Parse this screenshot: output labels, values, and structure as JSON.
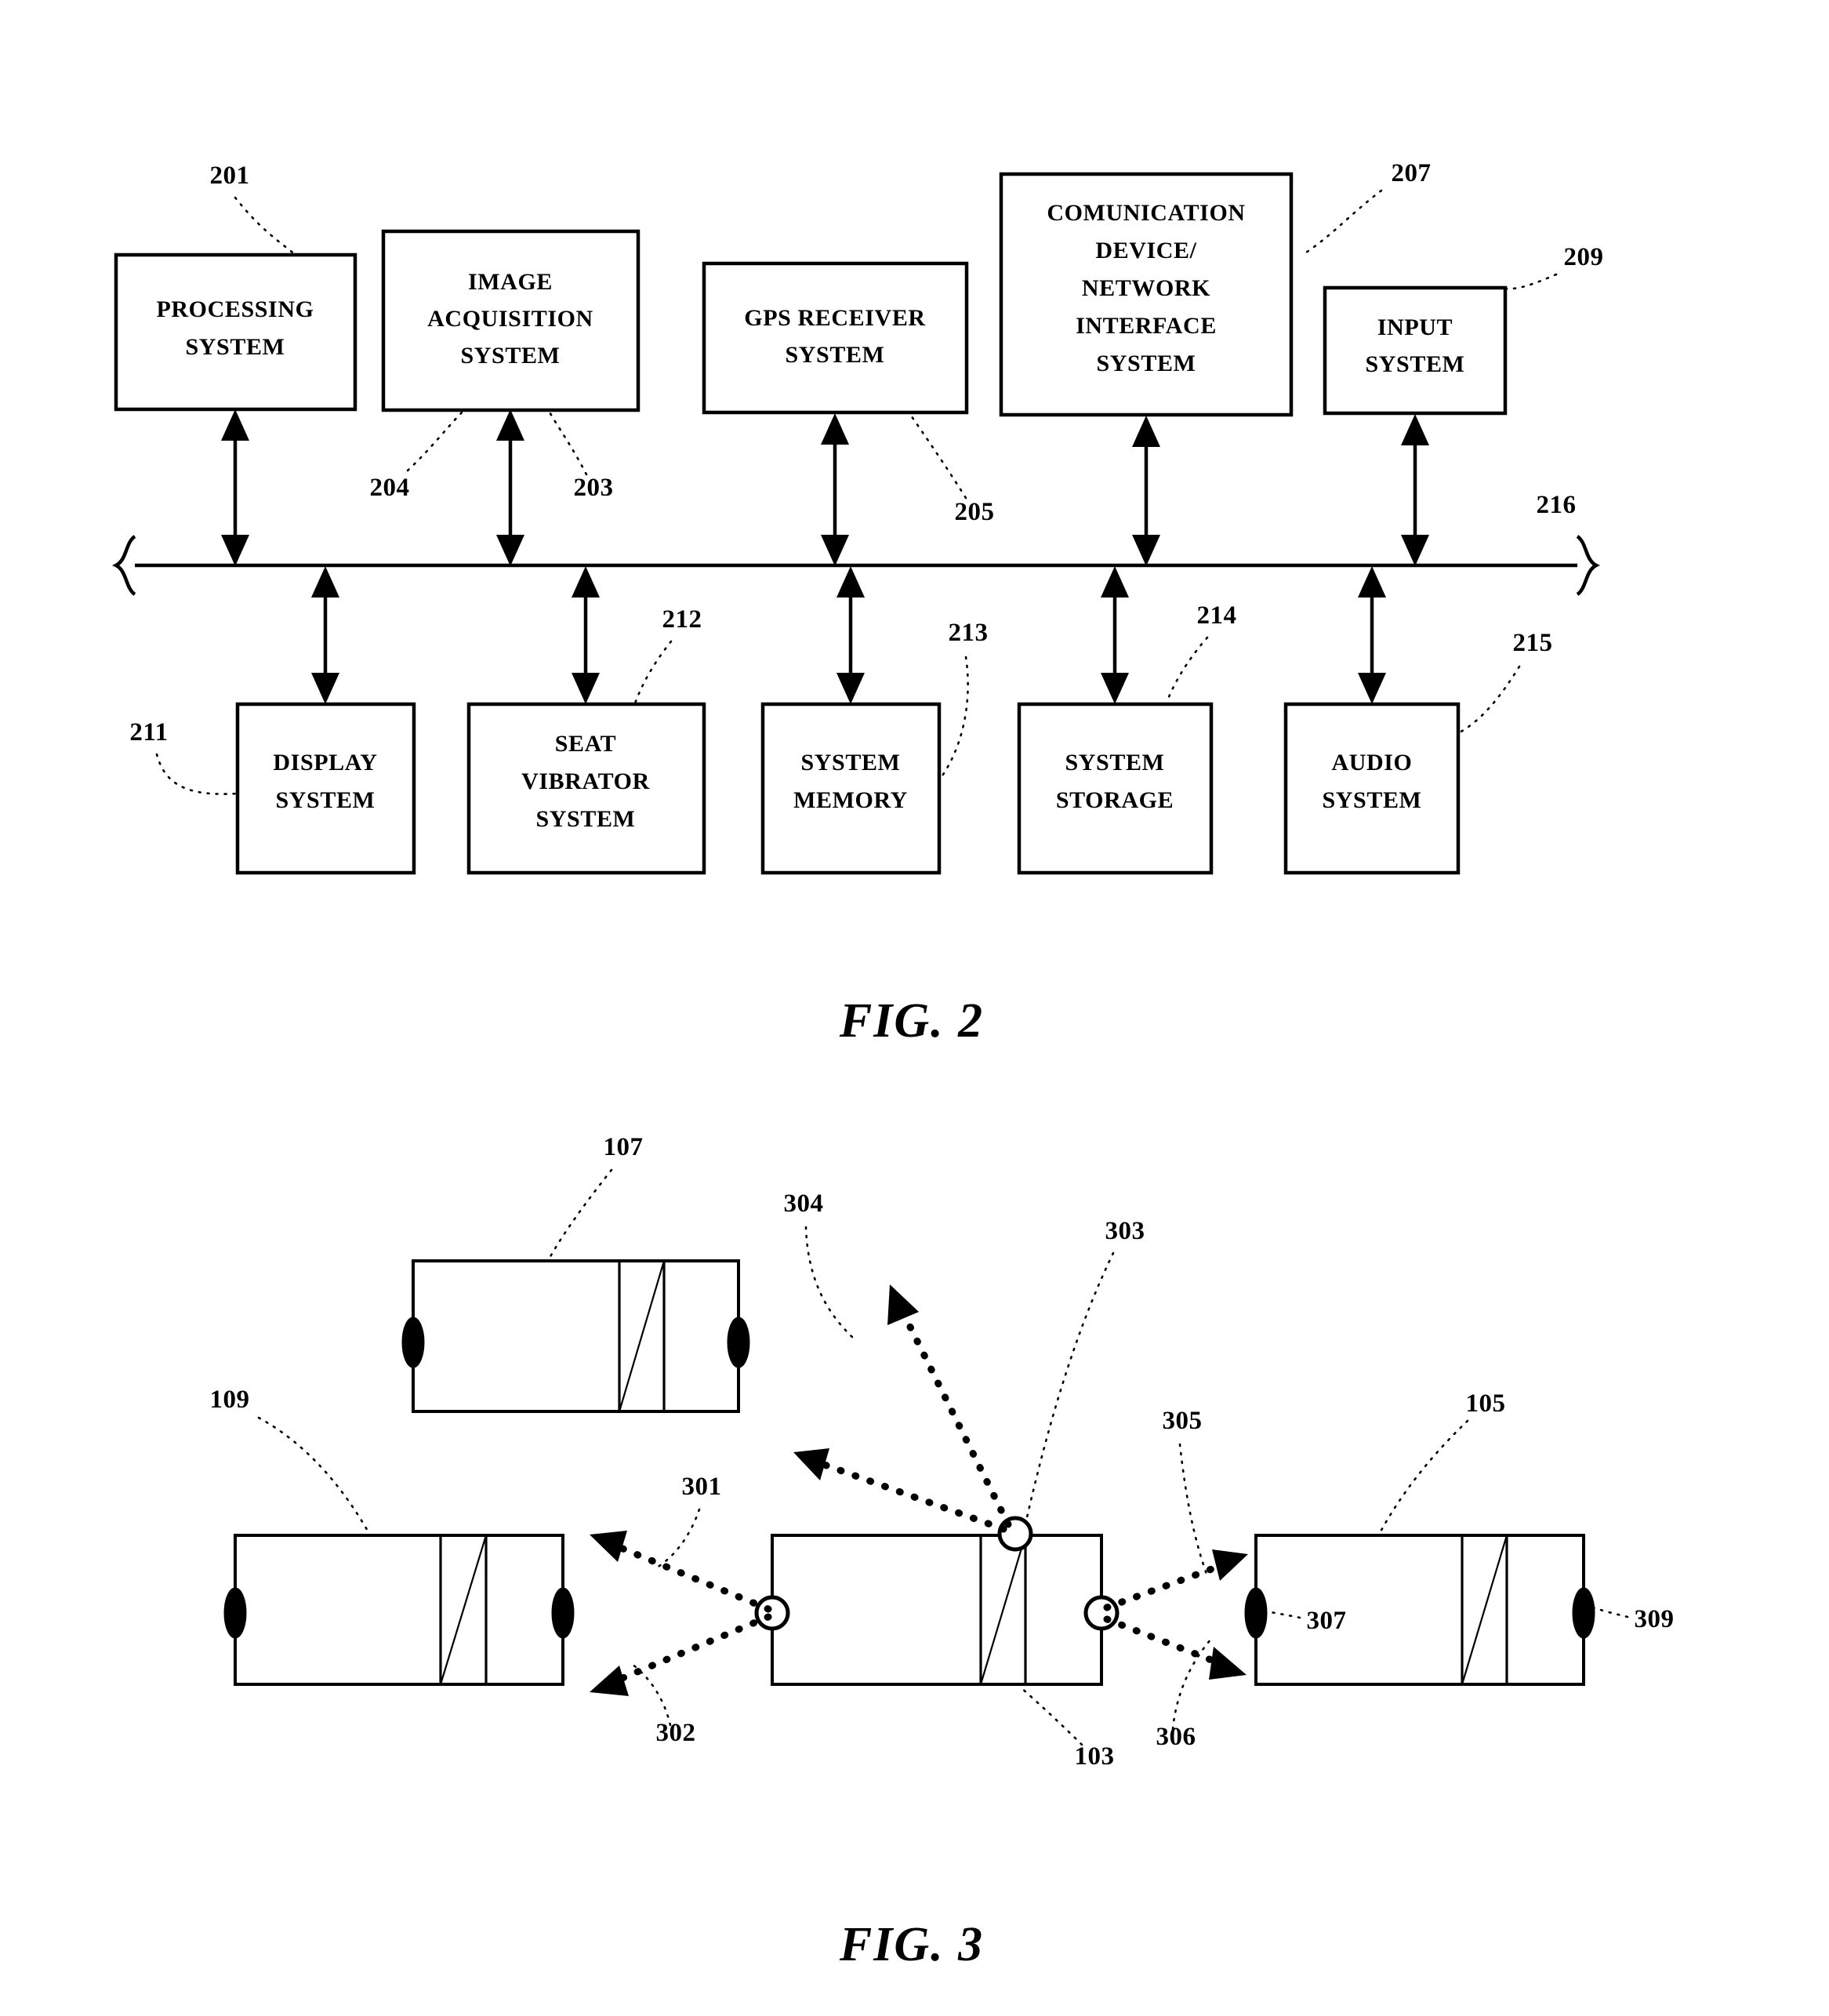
{
  "document": {
    "type": "patent-drawing-sheet",
    "figures": [
      {
        "id": "fig2",
        "caption": "FIG. 2",
        "title": "Vehicle system block diagram",
        "bus_label": "216",
        "top_blocks": [
          {
            "ref": "201",
            "label_lines": [
              "PROCESSING",
              "SYSTEM"
            ]
          },
          {
            "ref": "203",
            "label_lines": [
              "IMAGE",
              "ACQUISITION",
              "SYSTEM"
            ]
          },
          {
            "ref": "205",
            "label_lines": [
              "GPS RECEIVER",
              "SYSTEM"
            ]
          },
          {
            "ref": "207",
            "label_lines": [
              "COMUNICATION",
              "DEVICE/",
              "NETWORK",
              "INTERFACE",
              "SYSTEM"
            ]
          },
          {
            "ref": "209",
            "label_lines": [
              "INPUT",
              "SYSTEM"
            ]
          }
        ],
        "extra_top_ref": "204",
        "bottom_blocks": [
          {
            "ref": "211",
            "label_lines": [
              "DISPLAY",
              "SYSTEM"
            ]
          },
          {
            "ref": "212",
            "label_lines": [
              "SEAT",
              "VIBRATOR",
              "SYSTEM"
            ]
          },
          {
            "ref": "213",
            "label_lines": [
              "SYSTEM",
              "MEMORY"
            ]
          },
          {
            "ref": "214",
            "label_lines": [
              "SYSTEM",
              "STORAGE"
            ]
          },
          {
            "ref": "215",
            "label_lines": [
              "AUDIO",
              "SYSTEM"
            ]
          }
        ]
      },
      {
        "id": "fig3",
        "caption": "FIG. 3",
        "title": "Vehicles with mirrors and signal rays",
        "vehicles": [
          {
            "ref": "107",
            "position": "top-center",
            "mirror_style": "filled"
          },
          {
            "ref": "109",
            "position": "left",
            "mirror_style": "filled"
          },
          {
            "ref": "103",
            "position": "center",
            "mirror_style": "open"
          },
          {
            "ref": "105",
            "position": "right",
            "mirror_style": "filled"
          }
        ],
        "rays": [
          {
            "ref": "301",
            "desc": "upper-left ray from left sensor of 103"
          },
          {
            "ref": "302",
            "desc": "lower-left ray from left sensor of 103"
          },
          {
            "ref": "303",
            "desc": "top-right sensor of 103"
          },
          {
            "ref": "304",
            "desc": "upper-left ray from top sensor of 103"
          },
          {
            "ref": "305",
            "desc": "upper-right ray toward 105"
          },
          {
            "ref": "306",
            "desc": "lower-right ray toward 105"
          }
        ],
        "mirror_refs": [
          {
            "ref": "307",
            "desc": "left mirror of vehicle 105"
          },
          {
            "ref": "309",
            "desc": "right mirror of vehicle 105"
          }
        ]
      }
    ]
  },
  "fig2": {
    "caption": "FIG. 2",
    "bus_ref": "216",
    "top": {
      "b0": {
        "ref": "201",
        "l0": "PROCESSING",
        "l1": "SYSTEM"
      },
      "b1": {
        "ref": "203",
        "l0": "IMAGE",
        "l1": "ACQUISITION",
        "l2": "SYSTEM",
        "ref2": "204"
      },
      "b2": {
        "ref": "205",
        "l0": "GPS RECEIVER",
        "l1": "SYSTEM"
      },
      "b3": {
        "ref": "207",
        "l0": "COMUNICATION",
        "l1": "DEVICE/",
        "l2": "NETWORK",
        "l3": "INTERFACE",
        "l4": "SYSTEM"
      },
      "b4": {
        "ref": "209",
        "l0": "INPUT",
        "l1": "SYSTEM"
      }
    },
    "bottom": {
      "b0": {
        "ref": "211",
        "l0": "DISPLAY",
        "l1": "SYSTEM"
      },
      "b1": {
        "ref": "212",
        "l0": "SEAT",
        "l1": "VIBRATOR",
        "l2": "SYSTEM"
      },
      "b2": {
        "ref": "213",
        "l0": "SYSTEM",
        "l1": "MEMORY"
      },
      "b3": {
        "ref": "214",
        "l0": "SYSTEM",
        "l1": "STORAGE"
      },
      "b4": {
        "ref": "215",
        "l0": "AUDIO",
        "l1": "SYSTEM"
      }
    }
  },
  "fig3": {
    "caption": "FIG. 3",
    "v107": "107",
    "v109": "109",
    "v103": "103",
    "v105": "105",
    "r301": "301",
    "r302": "302",
    "r303": "303",
    "r304": "304",
    "r305": "305",
    "r306": "306",
    "m307": "307",
    "m309": "309"
  },
  "colors": {
    "ink": "#000000",
    "paper": "#ffffff"
  }
}
